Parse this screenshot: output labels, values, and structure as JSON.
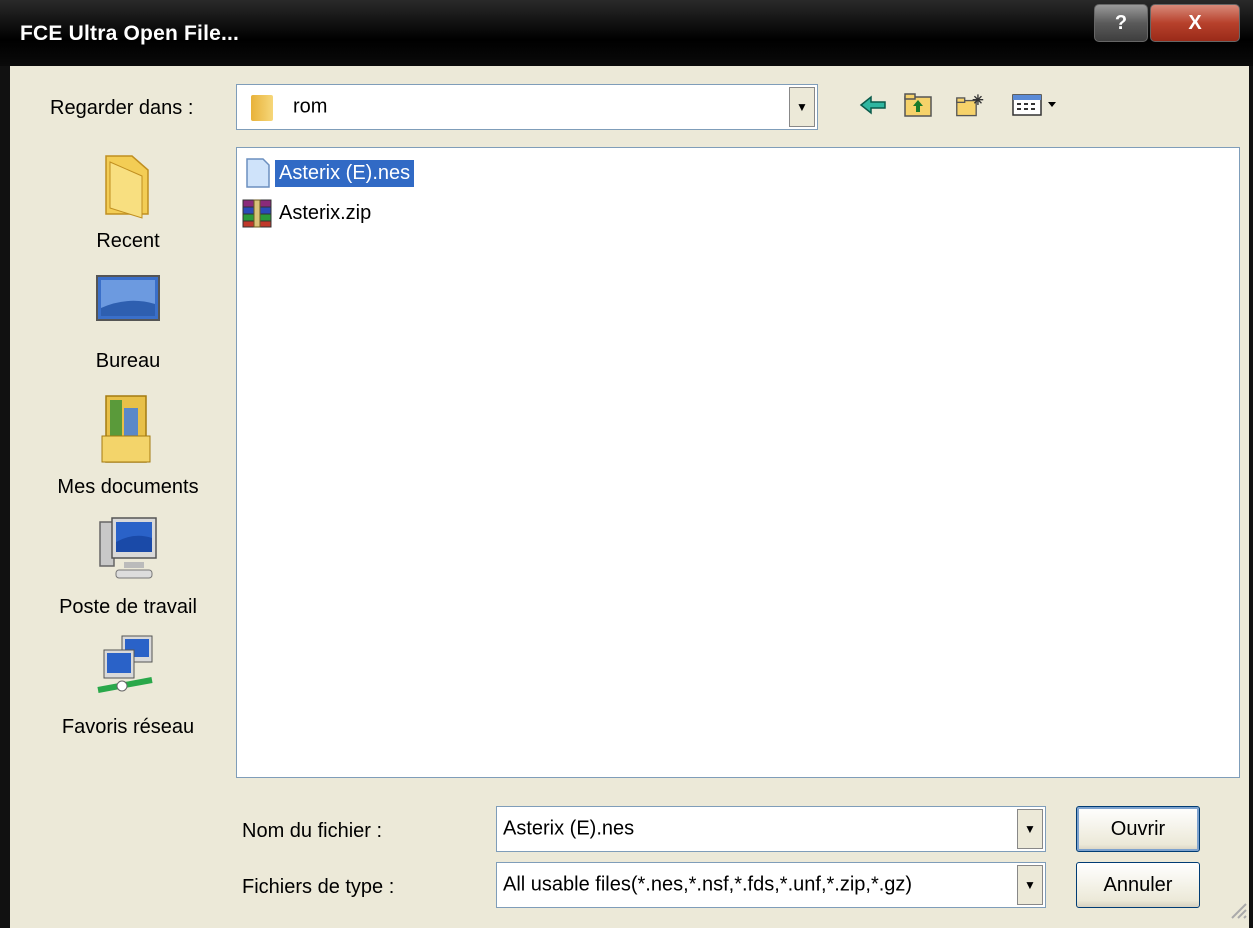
{
  "window": {
    "title": "FCE Ultra Open File...",
    "help_label": "?",
    "close_label": "X"
  },
  "lookin": {
    "label": "Regarder dans :",
    "value": "rom"
  },
  "places": [
    {
      "label": "Recent",
      "icon": "recent-folder-icon"
    },
    {
      "label": "Bureau",
      "icon": "desktop-icon"
    },
    {
      "label": "Mes documents",
      "icon": "my-documents-icon"
    },
    {
      "label": "Poste de travail",
      "icon": "my-computer-icon"
    },
    {
      "label": "Favoris réseau",
      "icon": "network-places-icon"
    }
  ],
  "files": [
    {
      "name": "Asterix (E).nes",
      "icon": "nes-file-icon",
      "selected": true
    },
    {
      "name": "Asterix.zip",
      "icon": "winrar-archive-icon",
      "selected": false
    }
  ],
  "filename": {
    "label": "Nom du fichier :",
    "value": "Asterix (E).nes"
  },
  "filetype": {
    "label": "Fichiers de type :",
    "value": "All usable files(*.nes,*.nsf,*.fds,*.unf,*.zip,*.gz)"
  },
  "buttons": {
    "open": "Ouvrir",
    "cancel": "Annuler"
  },
  "colors": {
    "selection": "#316ac5",
    "dialog_bg": "#ece9d8",
    "title_bg": "#000000"
  }
}
